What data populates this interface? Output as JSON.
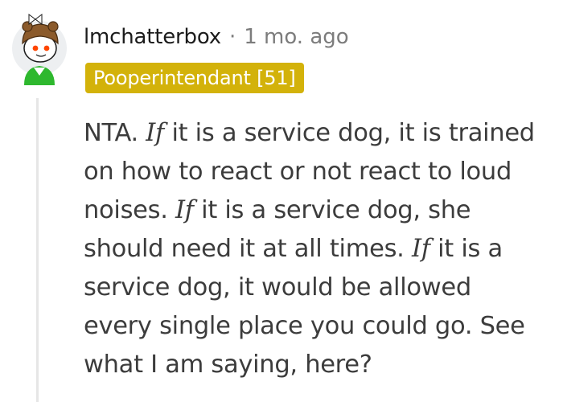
{
  "comment": {
    "author": "lmchatterbox",
    "separator": "·",
    "timestamp": "1 mo. ago",
    "flair": "Pooperintendant [51]",
    "flair_color": "#d3b20a",
    "body_lines": [
      [
        {
          "t": "NTA. "
        },
        {
          "t": "If",
          "em": true
        },
        {
          "t": " it is a service dog, it is trained"
        }
      ],
      [
        {
          "t": "on how to react or not react to loud"
        }
      ],
      [
        {
          "t": "noises. "
        },
        {
          "t": "If",
          "em": true
        },
        {
          "t": " it is a service dog, she"
        }
      ],
      [
        {
          "t": "should need it at all times. "
        },
        {
          "t": "If",
          "em": true
        },
        {
          "t": " it is a"
        }
      ],
      [
        {
          "t": "service dog, it would be allowed"
        }
      ],
      [
        {
          "t": "every single place you could go. See"
        }
      ],
      [
        {
          "t": "what I am saying, here?"
        }
      ]
    ]
  }
}
